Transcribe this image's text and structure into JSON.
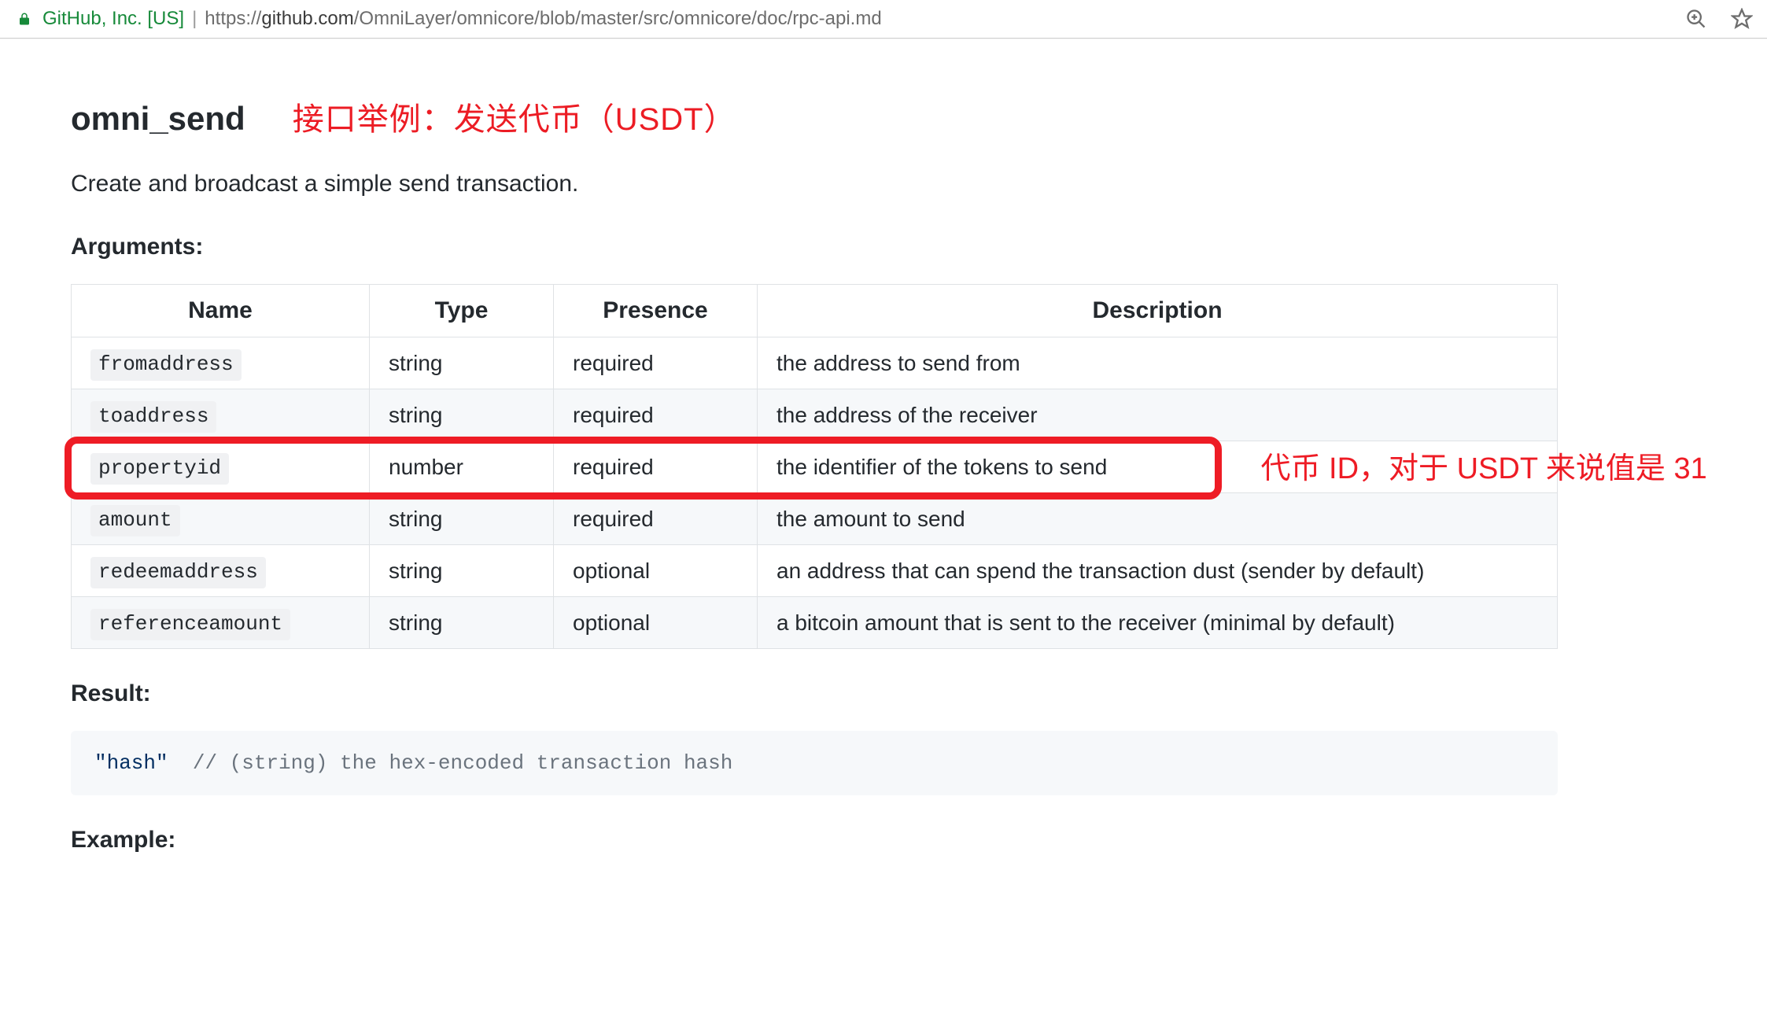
{
  "browser": {
    "secure_owner": "GitHub, Inc. [US]",
    "url_scheme": "https://",
    "url_host": "github.com",
    "url_path": "/OmniLayer/omnicore/blob/master/src/omnicore/doc/rpc-api.md"
  },
  "doc": {
    "api_name": "omni_send",
    "title_annotation": "接口举例：发送代币（USDT）",
    "description": "Create and broadcast a simple send transaction.",
    "arguments_label": "Arguments:",
    "result_label": "Result:",
    "example_label": "Example:",
    "table": {
      "headers": {
        "name": "Name",
        "type": "Type",
        "presence": "Presence",
        "description": "Description"
      },
      "rows": [
        {
          "name": "fromaddress",
          "type": "string",
          "presence": "required",
          "description": "the address to send from"
        },
        {
          "name": "toaddress",
          "type": "string",
          "presence": "required",
          "description": "the address of the receiver"
        },
        {
          "name": "propertyid",
          "type": "number",
          "presence": "required",
          "description": "the identifier of the tokens to send"
        },
        {
          "name": "amount",
          "type": "string",
          "presence": "required",
          "description": "the amount to send"
        },
        {
          "name": "redeemaddress",
          "type": "string",
          "presence": "optional",
          "description": "an address that can spend the transaction dust (sender by default)"
        },
        {
          "name": "referenceamount",
          "type": "string",
          "presence": "optional",
          "description": "a bitcoin amount that is sent to the receiver (minimal by default)"
        }
      ],
      "highlight_row_index": 2
    },
    "row_annotation": "代币 ID，对于 USDT 来说值是 31",
    "result_block": {
      "literal": "\"hash\"",
      "comment": "// (string) the hex-encoded transaction hash"
    }
  }
}
